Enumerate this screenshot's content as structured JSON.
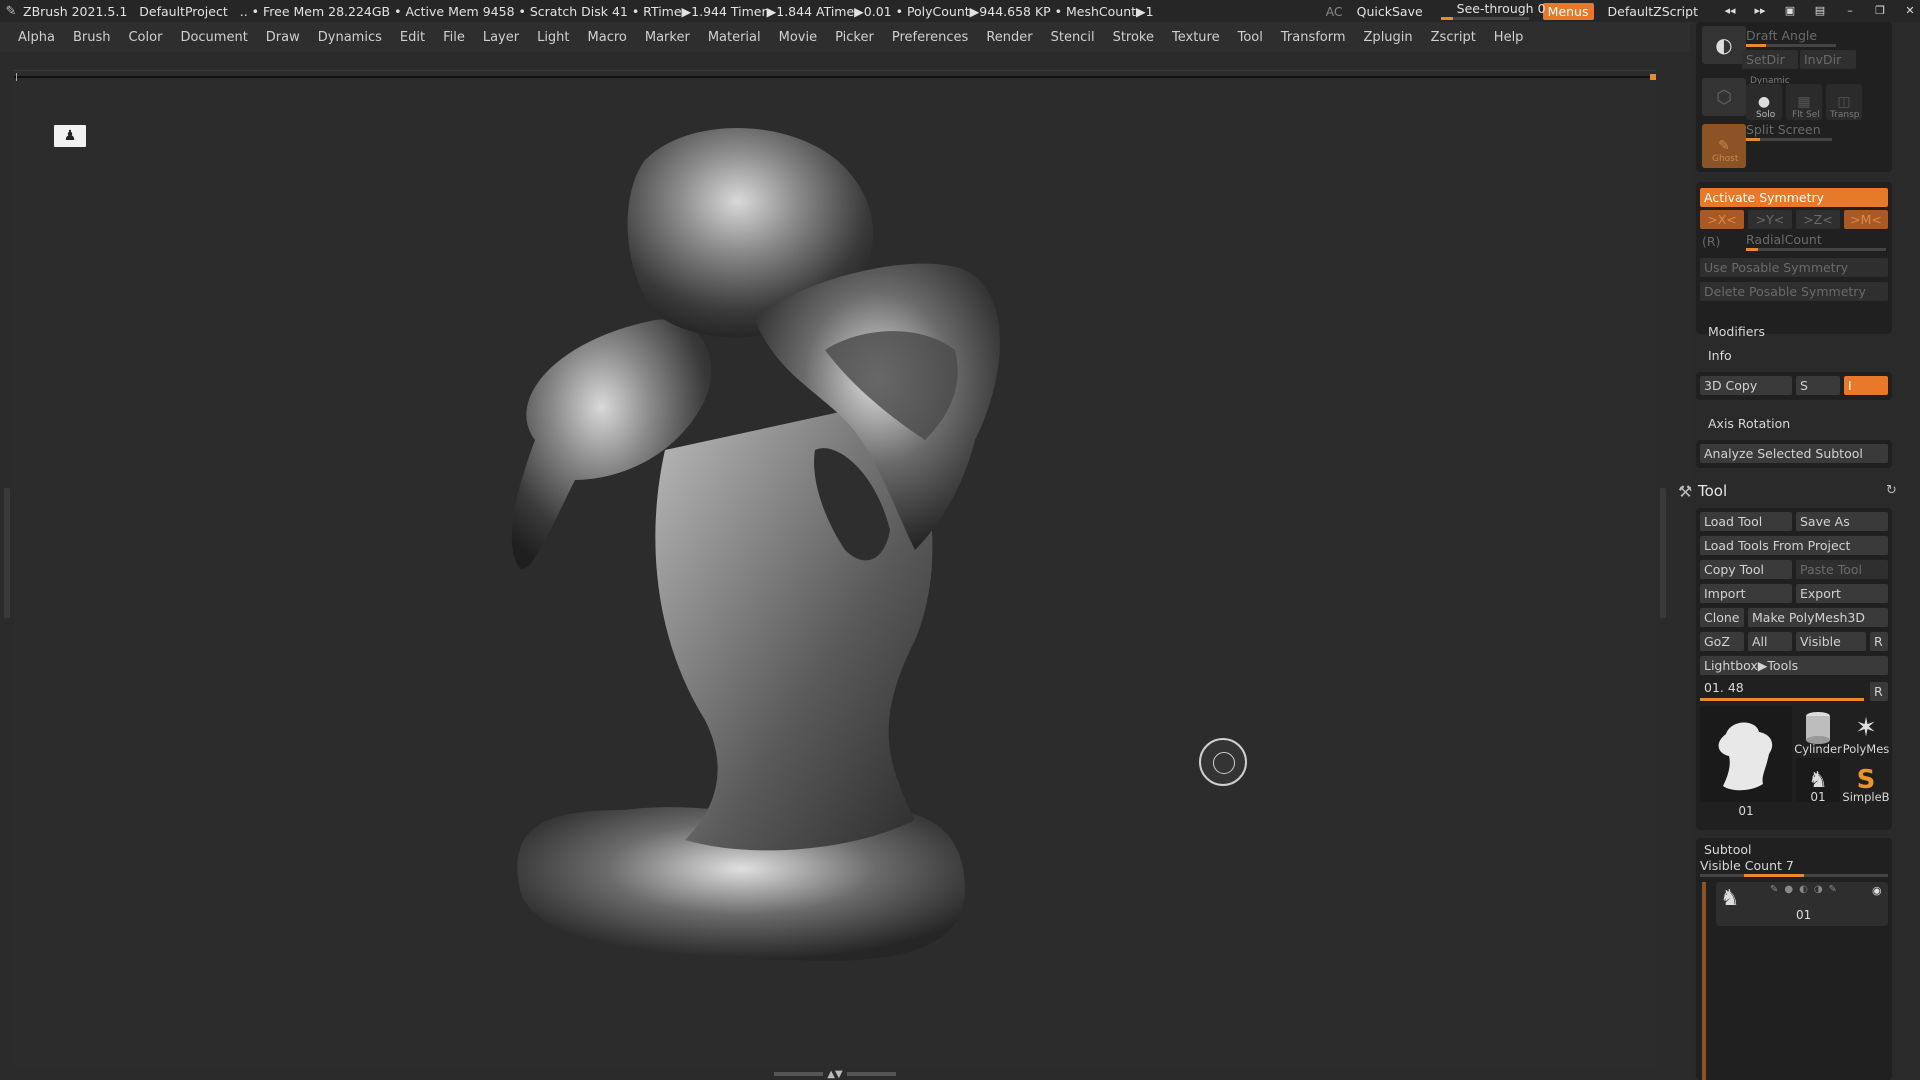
{
  "titlebar": {
    "app_title": "ZBrush 2021.5.1",
    "project": "DefaultProject",
    "stats": "..  • Free Mem 28.224GB • Active Mem 9458 • Scratch Disk 41 •  RTime▶1.944 Timer▶1.844 ATime▶0.01 • PolyCount▶944.658 KP  • MeshCount▶1",
    "ac": "AC",
    "quicksave": "QuickSave",
    "seethrough": "See-through  0",
    "seethrough_fraction": 0.0,
    "menus": "Menus",
    "script": "DefaultZScript"
  },
  "menubar": [
    "Alpha",
    "Brush",
    "Color",
    "Document",
    "Draw",
    "Dynamics",
    "Edit",
    "File",
    "Layer",
    "Light",
    "Macro",
    "Marker",
    "Material",
    "Movie",
    "Picker",
    "Preferences",
    "Render",
    "Stencil",
    "Stroke",
    "Texture",
    "Tool",
    "Transform",
    "Zplugin",
    "Zscript",
    "Help"
  ],
  "panel": {
    "draft_angle": "Draft Angle",
    "setdir": "SetDir",
    "invdir": "InvDir",
    "dynamic": "Dynamic",
    "solo": "Solo",
    "fltsel": "Flt Sel",
    "transp": "Transp",
    "ghost": "Ghost",
    "split_screen": "Split Screen",
    "activate_symmetry": "Activate Symmetry",
    "sym_x": ">X<",
    "sym_y": ">Y<",
    "sym_z": ">Z<",
    "sym_m": ">M<",
    "radial_r": "(R)",
    "radial_count": "RadialCount",
    "use_posable": "Use Posable Symmetry",
    "delete_posable": "Delete Posable Symmetry",
    "modifiers": "Modifiers",
    "info": "Info",
    "copy3d": "3D Copy",
    "copy_s": "S",
    "copy_i": "I",
    "axis_rotation": "Axis Rotation",
    "analyze": "Analyze Selected Subtool"
  },
  "tool": {
    "title": "Tool",
    "load_tool": "Load Tool",
    "save_as": "Save As",
    "load_from_project": "Load Tools From Project",
    "copy_tool": "Copy Tool",
    "paste_tool": "Paste Tool",
    "import": "Import",
    "export": "Export",
    "clone": "Clone",
    "make_polymesh": "Make PolyMesh3D",
    "goz": "GoZ",
    "all": "All",
    "visible": "Visible",
    "r": "R",
    "lightbox": "Lightbox▶Tools",
    "current_tool": "01. 48",
    "thumbs": [
      {
        "label": "01"
      },
      {
        "label": "Cylinder"
      },
      {
        "label": "PolyMes"
      },
      {
        "label": "01"
      },
      {
        "label": "SimpleB"
      }
    ]
  },
  "subtool": {
    "title": "Subtool",
    "visible_count": "Visible Count 7",
    "item_label": "01"
  },
  "colors": {
    "accent": "#e8792a",
    "panel_bg": "#2a2a2a",
    "viewport_bg": "#2c2c2c"
  }
}
